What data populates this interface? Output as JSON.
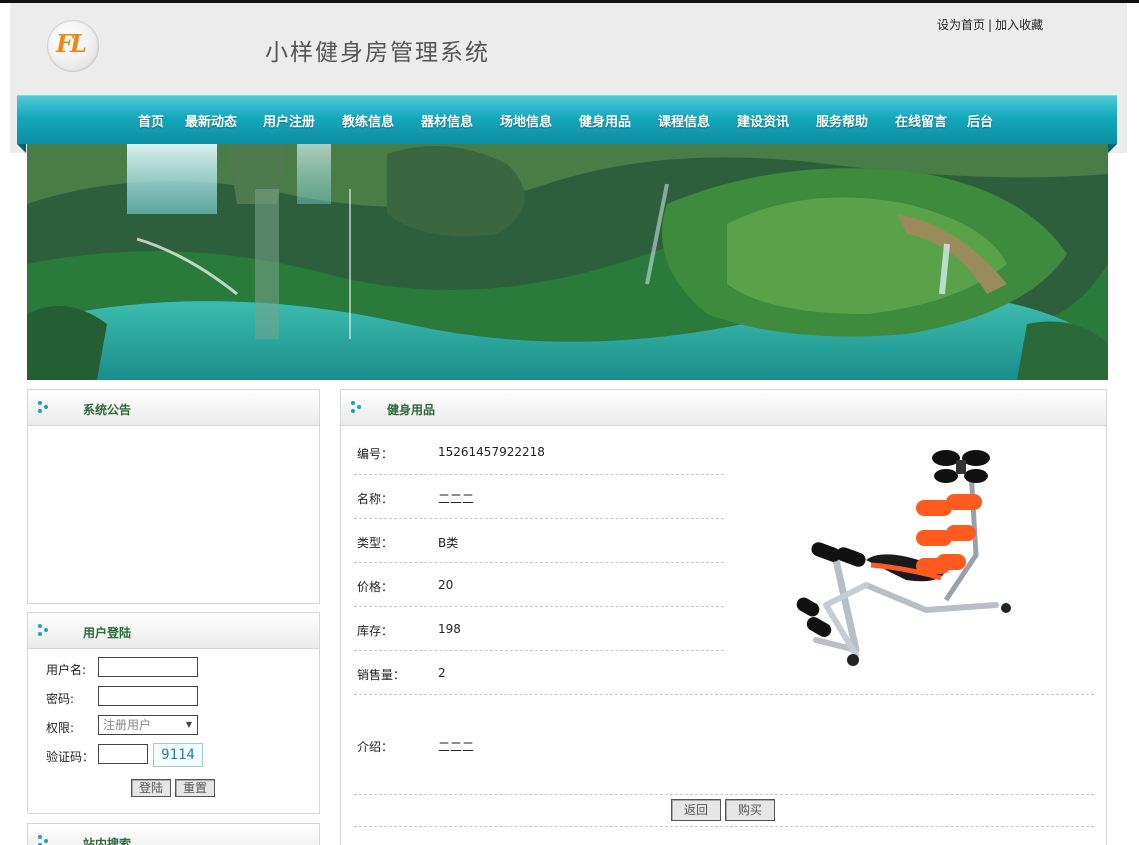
{
  "header": {
    "logo_text": "FL",
    "site_title": "小样健身房管理系统",
    "set_home": "设为首页",
    "separator": "|",
    "add_favorite": "加入收藏"
  },
  "nav": {
    "items": [
      "首页",
      "最新动态",
      "用户注册",
      "教练信息",
      "器材信息",
      "场地信息",
      "健身用品",
      "课程信息",
      "建设资讯",
      "服务帮助",
      "在线留言",
      "后台"
    ]
  },
  "sidebar": {
    "notice": {
      "title": "系统公告"
    },
    "login": {
      "title": "用户登陆",
      "username_label": "用户名:",
      "username_value": "",
      "password_label": "密码:",
      "password_value": "",
      "role_label": "权限:",
      "role_selected": "注册用户",
      "captcha_label": "验证码：",
      "captcha_value": "",
      "captcha_code": "9114",
      "login_button": "登陆",
      "reset_button": "重置"
    },
    "search": {
      "title": "站内搜索"
    }
  },
  "product": {
    "panel_title": "健身用品",
    "fields": [
      {
        "label": "编号：",
        "value": "15261457922218"
      },
      {
        "label": "名称：",
        "value": "二二二"
      },
      {
        "label": "类型：",
        "value": "B类"
      },
      {
        "label": "价格：",
        "value": "20"
      },
      {
        "label": "库存：",
        "value": "198"
      },
      {
        "label": "销售量：",
        "value": "2"
      }
    ],
    "intro_label": "介绍：",
    "intro_value": "二二二",
    "back_button": "返回",
    "buy_button": "购买",
    "image_icon": "ab-bench-image"
  }
}
